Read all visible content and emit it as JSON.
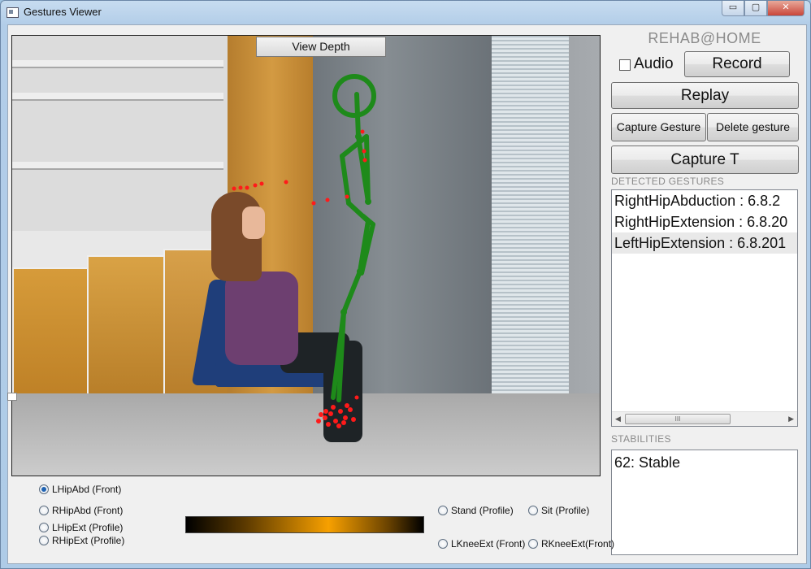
{
  "window": {
    "title": "Gestures Viewer",
    "controls": {
      "minimize": "▭",
      "maximize": "▢",
      "close": "✕"
    }
  },
  "video": {
    "view_button": "View Depth"
  },
  "side": {
    "brand": "REHAB@HOME",
    "audio_label": "Audio",
    "audio_checked": false,
    "record_label": "Record",
    "replay_label": "Replay",
    "capture_gesture_label": "Capture Gesture",
    "delete_gesture_label": "Delete gesture",
    "capture_t_label": "Capture T",
    "detected_title": "DETECTED GESTURES",
    "detected": [
      "RightHipAbduction : 6.8.2",
      "RightHipExtension : 6.8.20",
      "LeftHipExtension : 6.8.201"
    ],
    "stabilities_title": "STABILITIES",
    "stabilities": [
      "62: Stable"
    ],
    "scroll_left": "◀",
    "scroll_right": "▶",
    "scroll_grip": "III"
  },
  "gestures": {
    "left": [
      {
        "label": "LHipAbd (Front)",
        "checked": true
      },
      {
        "label": "RHipAbd (Front)",
        "checked": false
      },
      {
        "label": "LHipExt (Profile)",
        "checked": false
      },
      {
        "label": "RHipExt (Profile)",
        "checked": false
      }
    ],
    "right": [
      {
        "label": "Stand (Profile)",
        "checked": false
      },
      {
        "label": "Sit (Profile)",
        "checked": false
      },
      {
        "label": "LKneeExt (Front)",
        "checked": false
      },
      {
        "label": "RKneeExt(Front)",
        "checked": false
      }
    ]
  },
  "colors": {
    "skeleton": "#1e8a1a",
    "joints": "#ff1a1a",
    "accent": "#1f63b3"
  }
}
